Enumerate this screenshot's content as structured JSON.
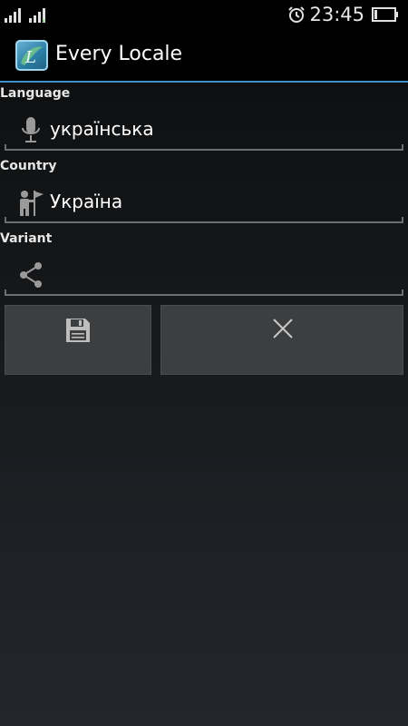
{
  "status_bar": {
    "time": "23:45",
    "icons": [
      "signal-icon",
      "signal-icon",
      "alarm-icon",
      "battery-icon"
    ]
  },
  "action_bar": {
    "app_icon": "app-logo-icon",
    "title": "Every Locale",
    "accent_color": "#3e90c6"
  },
  "form": {
    "language": {
      "label": "Language",
      "value": "українська",
      "icon": "microphone-icon"
    },
    "country": {
      "label": "Country",
      "value": "Україна",
      "icon": "person-flag-icon"
    },
    "variant": {
      "label": "Variant",
      "value": "",
      "icon": "share-icon"
    }
  },
  "buttons": {
    "save": {
      "icon": "floppy-disk-icon"
    },
    "cancel": {
      "icon": "close-icon"
    }
  }
}
